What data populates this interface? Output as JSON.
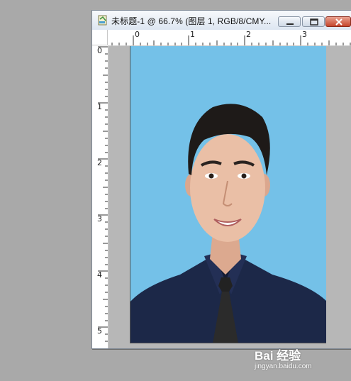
{
  "document_window": {
    "title": "未标题-1 @ 66.7% (图层 1, RGB/8/CMY...",
    "buttons": [
      "minimize",
      "restore",
      "close"
    ]
  },
  "rulers": {
    "top_labels": [
      "0",
      "1",
      "2",
      "3"
    ],
    "left_labels": [
      "0",
      "1",
      "2",
      "3",
      "4",
      "5"
    ]
  },
  "canvas": {
    "background_color": "#74c1e8",
    "subject": "portrait photo"
  },
  "watermark": {
    "brand": "Bai 经验",
    "url": "jingyan.baidu.com"
  },
  "colors": {
    "workspace": "#a9a9a9",
    "photo_background": "#74c1e8",
    "close_button": "#c5452c"
  }
}
